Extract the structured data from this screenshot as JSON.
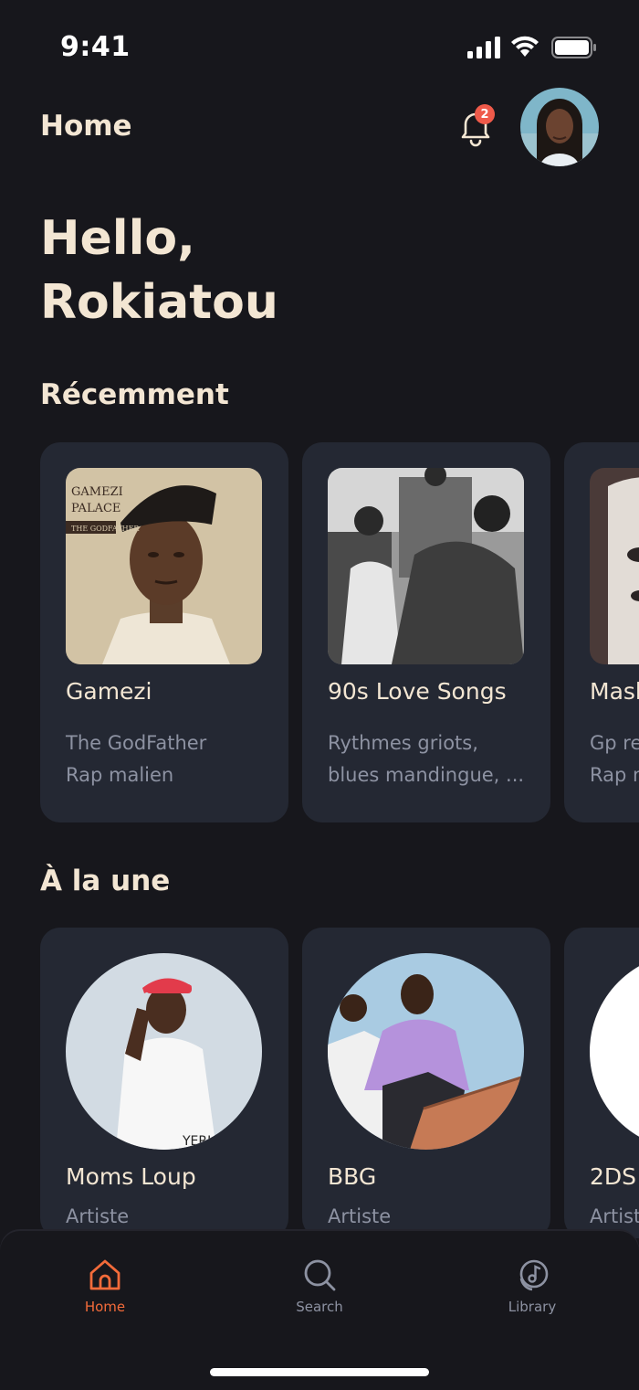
{
  "status_bar": {
    "time": "9:41"
  },
  "header": {
    "title": "Home",
    "notification_count": "2"
  },
  "greeting": {
    "line1": "Hello,",
    "line2": "Rokiatou"
  },
  "recent": {
    "title": "Récemment",
    "items": [
      {
        "title": "Gamezi",
        "line1": "The GodFather",
        "line2": "Rap malien"
      },
      {
        "title": "90s Love Songs",
        "line1": "Rythmes griots,",
        "line2": "blues mandingue, ..."
      },
      {
        "title": "Mask",
        "line1": "Gp re",
        "line2": "Rap m"
      }
    ]
  },
  "featured": {
    "title": "À la une",
    "items": [
      {
        "name": "Moms Loup",
        "role": "Artiste"
      },
      {
        "name": "BBG",
        "role": "Artiste"
      },
      {
        "name": "2DS",
        "role": "Artist"
      }
    ]
  },
  "nav": {
    "home": "Home",
    "search": "Search",
    "library": "Library"
  },
  "colors": {
    "background": "#17171c",
    "card": "#242833",
    "accent": "#f36b3a",
    "text": "#f3e6d3",
    "muted": "#8d92a2"
  }
}
